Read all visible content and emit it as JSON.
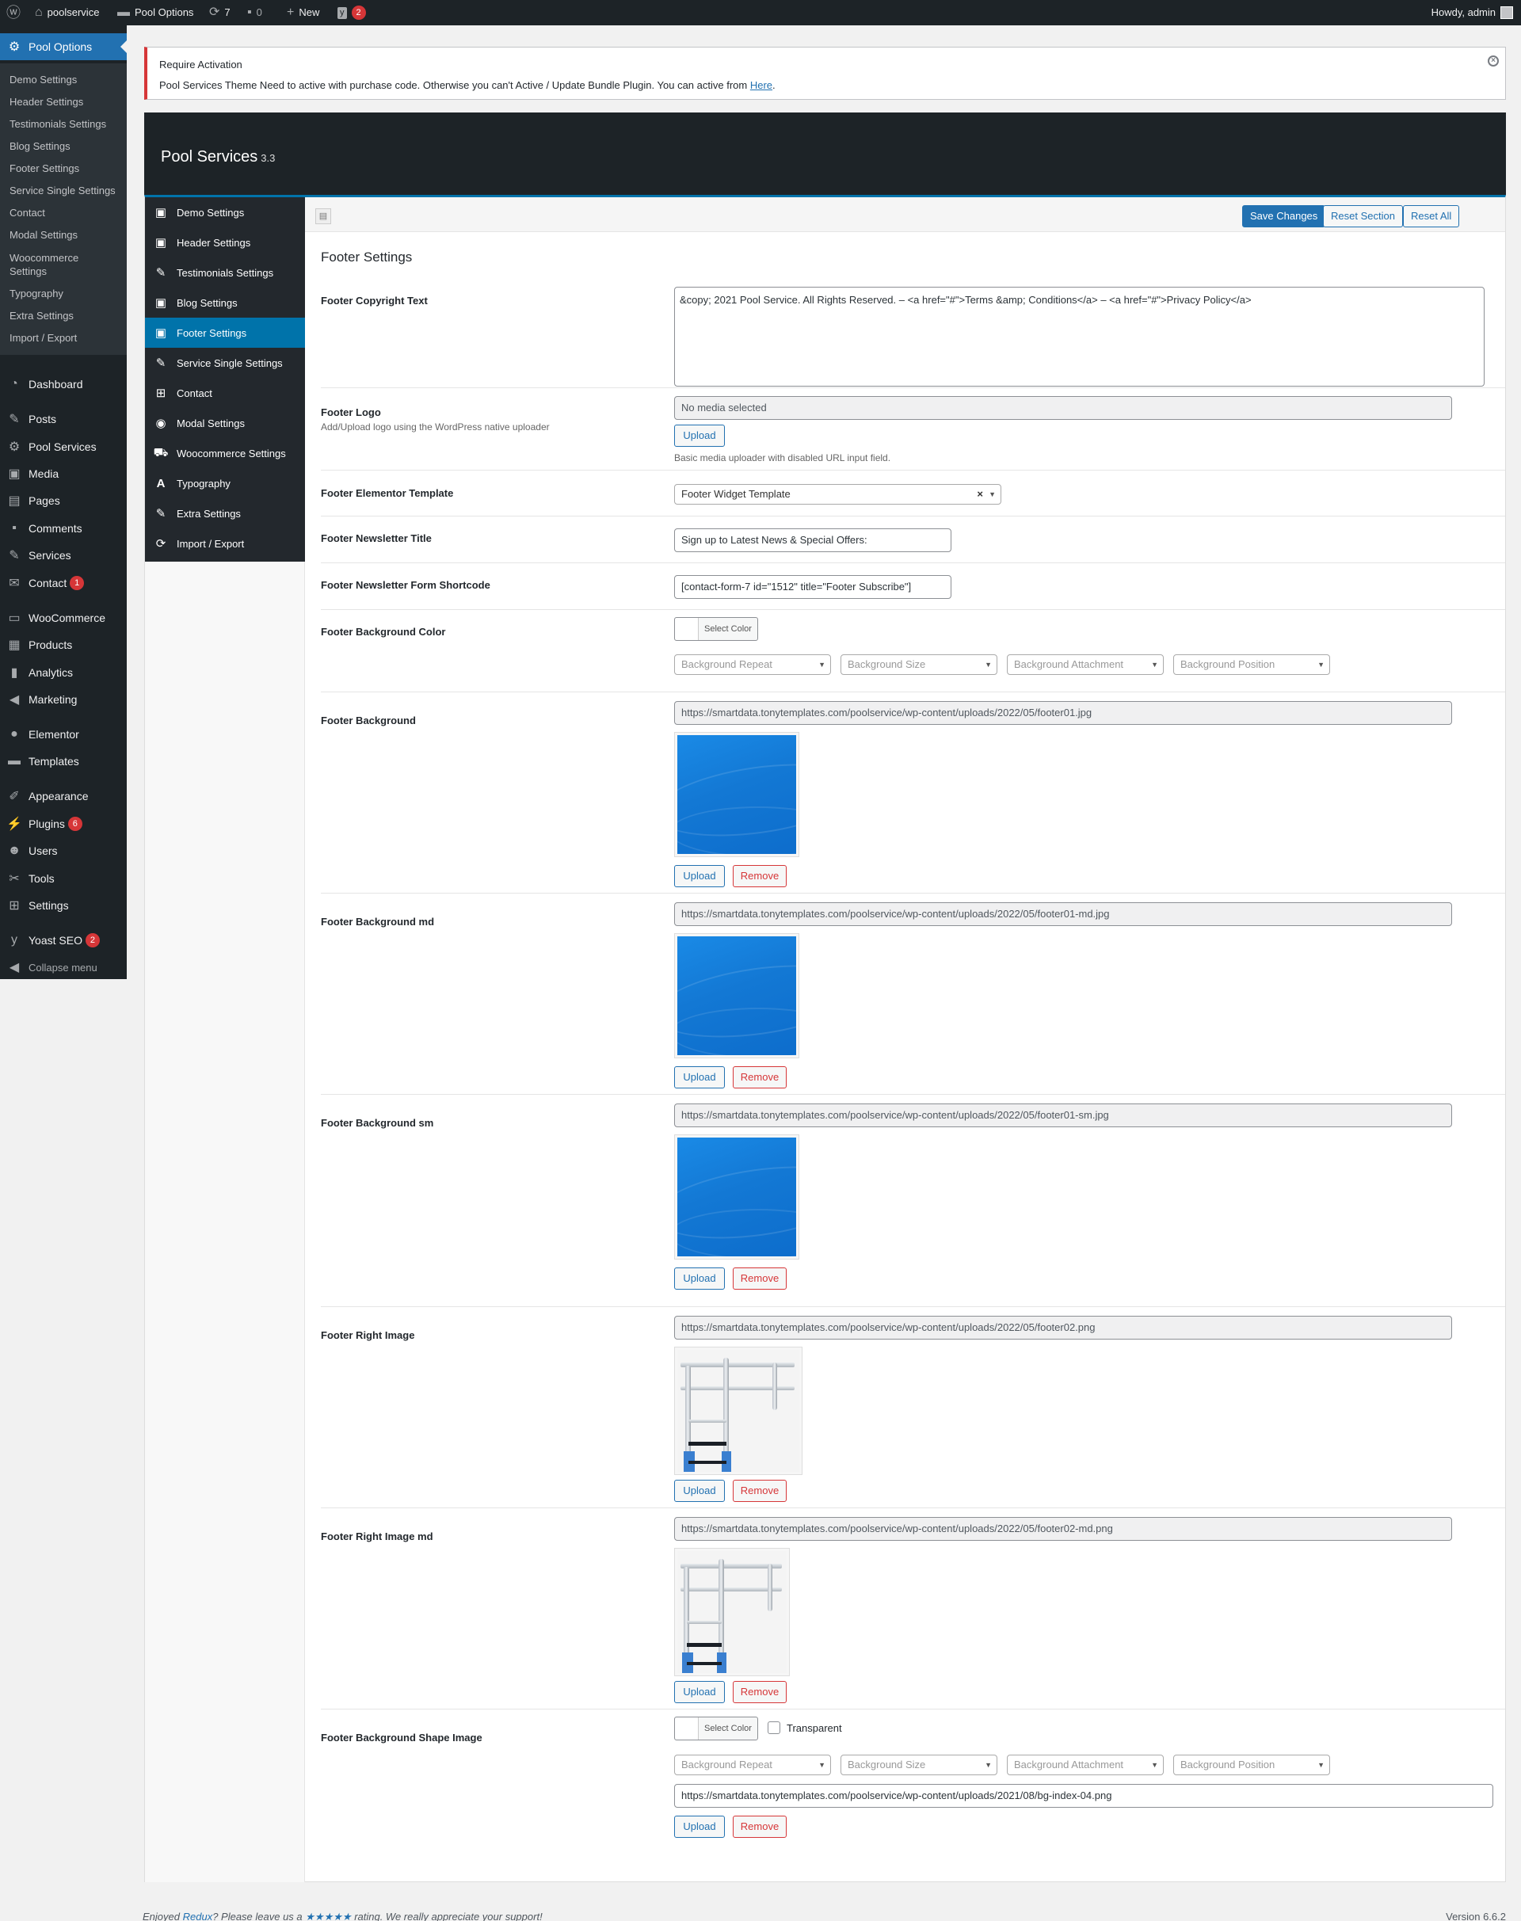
{
  "adminbar": {
    "site_name": "poolservice",
    "options_link": "Pool Options",
    "updates_count": "7",
    "comments_count": "0",
    "new_label": "New",
    "yoast_count": "2",
    "howdy": "Howdy, admin"
  },
  "adminmenu": {
    "current": "Pool Options",
    "submenu": [
      "Demo Settings",
      "Header Settings",
      "Testimonials Settings",
      "Blog Settings",
      "Footer Settings",
      "Service Single Settings",
      "Contact",
      "Modal Settings",
      "Woocommerce Settings",
      "Typography",
      "Extra Settings",
      "Import / Export"
    ],
    "items": {
      "dashboard": "Dashboard",
      "posts": "Posts",
      "pool_services": "Pool Services",
      "media": "Media",
      "pages": "Pages",
      "comments": "Comments",
      "services": "Services",
      "contact": "Contact",
      "contact_badge": "1",
      "woocommerce": "WooCommerce",
      "products": "Products",
      "analytics": "Analytics",
      "marketing": "Marketing",
      "elementor": "Elementor",
      "templates": "Templates",
      "appearance": "Appearance",
      "plugins": "Plugins",
      "plugins_badge": "6",
      "users": "Users",
      "tools": "Tools",
      "settings": "Settings",
      "yoast": "Yoast SEO",
      "yoast_badge": "2",
      "collapse": "Collapse menu"
    }
  },
  "notice": {
    "title": "Require Activation",
    "message": "Pool Services Theme Need to active with purchase code. Otherwise you can't Active / Update Bundle Plugin. You can active from",
    "link": "Here",
    "end": "."
  },
  "redux": {
    "title": "Pool Services",
    "version": "3.3",
    "nav": [
      "Demo Settings",
      "Header Settings",
      "Testimonials Settings",
      "Blog Settings",
      "Footer Settings",
      "Service Single Settings",
      "Contact",
      "Modal Settings",
      "Woocommerce Settings",
      "Typography",
      "Extra Settings",
      "Import / Export"
    ],
    "active_nav": "Footer Settings",
    "save": "Save Changes",
    "reset_section": "Reset Section",
    "reset_all": "Reset All"
  },
  "section_title": "Footer Settings",
  "fields": {
    "copyright": {
      "label": "Footer Copyright Text",
      "value": "&copy; 2021 Pool Service. All Rights Reserved. – <a href=\"#\">Terms &amp; Conditions</a> – <a href=\"#\">Privacy Policy</a>"
    },
    "logo": {
      "label": "Footer Logo",
      "desc": "Add/Upload logo using the WordPress native uploader",
      "value": "No media selected",
      "note": "Basic media uploader with disabled URL input field."
    },
    "elementor": {
      "label": "Footer Elementor Template",
      "value": "Footer Widget Template"
    },
    "newsletter_title": {
      "label": "Footer Newsletter Title",
      "value": "Sign up to Latest News & Special Offers:"
    },
    "newsletter_shortcode": {
      "label": "Footer Newsletter Form Shortcode",
      "value": "[contact-form-7 id=\"1512\" title=\"Footer Subscribe\"]"
    },
    "bg_color": {
      "label": "Footer Background Color"
    },
    "bg": {
      "label": "Footer Background",
      "url": "https://smartdata.tonytemplates.com/poolservice/wp-content/uploads/2022/05/footer01.jpg"
    },
    "bg_md": {
      "label": "Footer Background md",
      "url": "https://smartdata.tonytemplates.com/poolservice/wp-content/uploads/2022/05/footer01-md.jpg"
    },
    "bg_sm": {
      "label": "Footer Background sm",
      "url": "https://smartdata.tonytemplates.com/poolservice/wp-content/uploads/2022/05/footer01-sm.jpg"
    },
    "right": {
      "label": "Footer Right Image",
      "url": "https://smartdata.tonytemplates.com/poolservice/wp-content/uploads/2022/05/footer02.png"
    },
    "right_md": {
      "label": "Footer Right Image md",
      "url": "https://smartdata.tonytemplates.com/poolservice/wp-content/uploads/2022/05/footer02-md.png"
    },
    "shape": {
      "label": "Footer Background Shape Image",
      "transparent": "Transparent",
      "url": "https://smartdata.tonytemplates.com/poolservice/wp-content/uploads/2021/08/bg-index-04.png"
    }
  },
  "common": {
    "select_color": "Select Color",
    "upload": "Upload",
    "remove": "Remove",
    "bg_repeat": "Background Repeat",
    "bg_size": "Background Size",
    "bg_attachment": "Background Attachment",
    "bg_position": "Background Position"
  },
  "footer": {
    "text1": "Enjoyed",
    "redux": "Redux",
    "text2": "? Please leave us a",
    "stars": "★★★★★",
    "text3": "rating. We really appreciate your support!",
    "version": "Version 6.6.2"
  }
}
